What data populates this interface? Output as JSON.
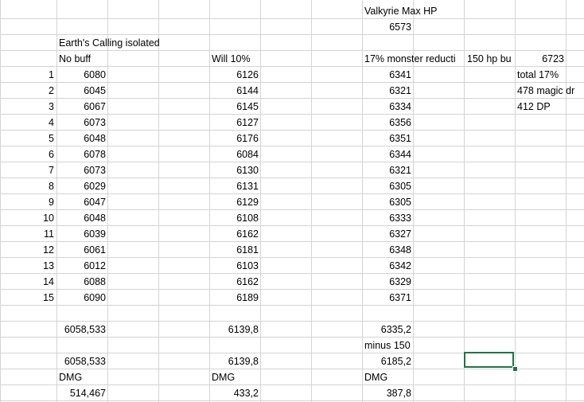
{
  "sheet": {
    "header_valkyrie": "Valkyrie Max HP",
    "valkyrie_value": "6573",
    "title": "Earth's Calling isolated",
    "col_no_buff": "No buff",
    "col_will": "Will 10%",
    "col_monster": "17% monster reducti",
    "col_hp_buff": "150 hp bu",
    "hp_buff_value": "6723",
    "note_total": "total 17%",
    "note_magic": "478 magic dr",
    "note_dp": "412 DP",
    "rows": [
      {
        "n": "1",
        "a": "6080",
        "b": "6126",
        "c": "6341"
      },
      {
        "n": "2",
        "a": "6045",
        "b": "6144",
        "c": "6321"
      },
      {
        "n": "3",
        "a": "6067",
        "b": "6145",
        "c": "6334"
      },
      {
        "n": "4",
        "a": "6073",
        "b": "6127",
        "c": "6356"
      },
      {
        "n": "5",
        "a": "6048",
        "b": "6176",
        "c": "6351"
      },
      {
        "n": "6",
        "a": "6078",
        "b": "6084",
        "c": "6344"
      },
      {
        "n": "7",
        "a": "6073",
        "b": "6130",
        "c": "6321"
      },
      {
        "n": "8",
        "a": "6029",
        "b": "6131",
        "c": "6305"
      },
      {
        "n": "9",
        "a": "6047",
        "b": "6129",
        "c": "6305"
      },
      {
        "n": "10",
        "a": "6048",
        "b": "6108",
        "c": "6333"
      },
      {
        "n": "11",
        "a": "6039",
        "b": "6162",
        "c": "6327"
      },
      {
        "n": "12",
        "a": "6061",
        "b": "6181",
        "c": "6348"
      },
      {
        "n": "13",
        "a": "6012",
        "b": "6103",
        "c": "6342"
      },
      {
        "n": "14",
        "a": "6088",
        "b": "6162",
        "c": "6329"
      },
      {
        "n": "15",
        "a": "6090",
        "b": "6189",
        "c": "6371"
      }
    ],
    "avg_a": "6058,533",
    "avg_b": "6139,8",
    "avg_c": "6335,2",
    "minus_label": "minus 150",
    "avg2_a": "6058,533",
    "avg2_b": "6139,8",
    "avg2_c": "6185,2",
    "dmg_label_a": "DMG",
    "dmg_label_b": "DMG",
    "dmg_label_c": "DMG",
    "dmg_a": "514,467",
    "dmg_b": "433,2",
    "dmg_c": "387,8"
  }
}
